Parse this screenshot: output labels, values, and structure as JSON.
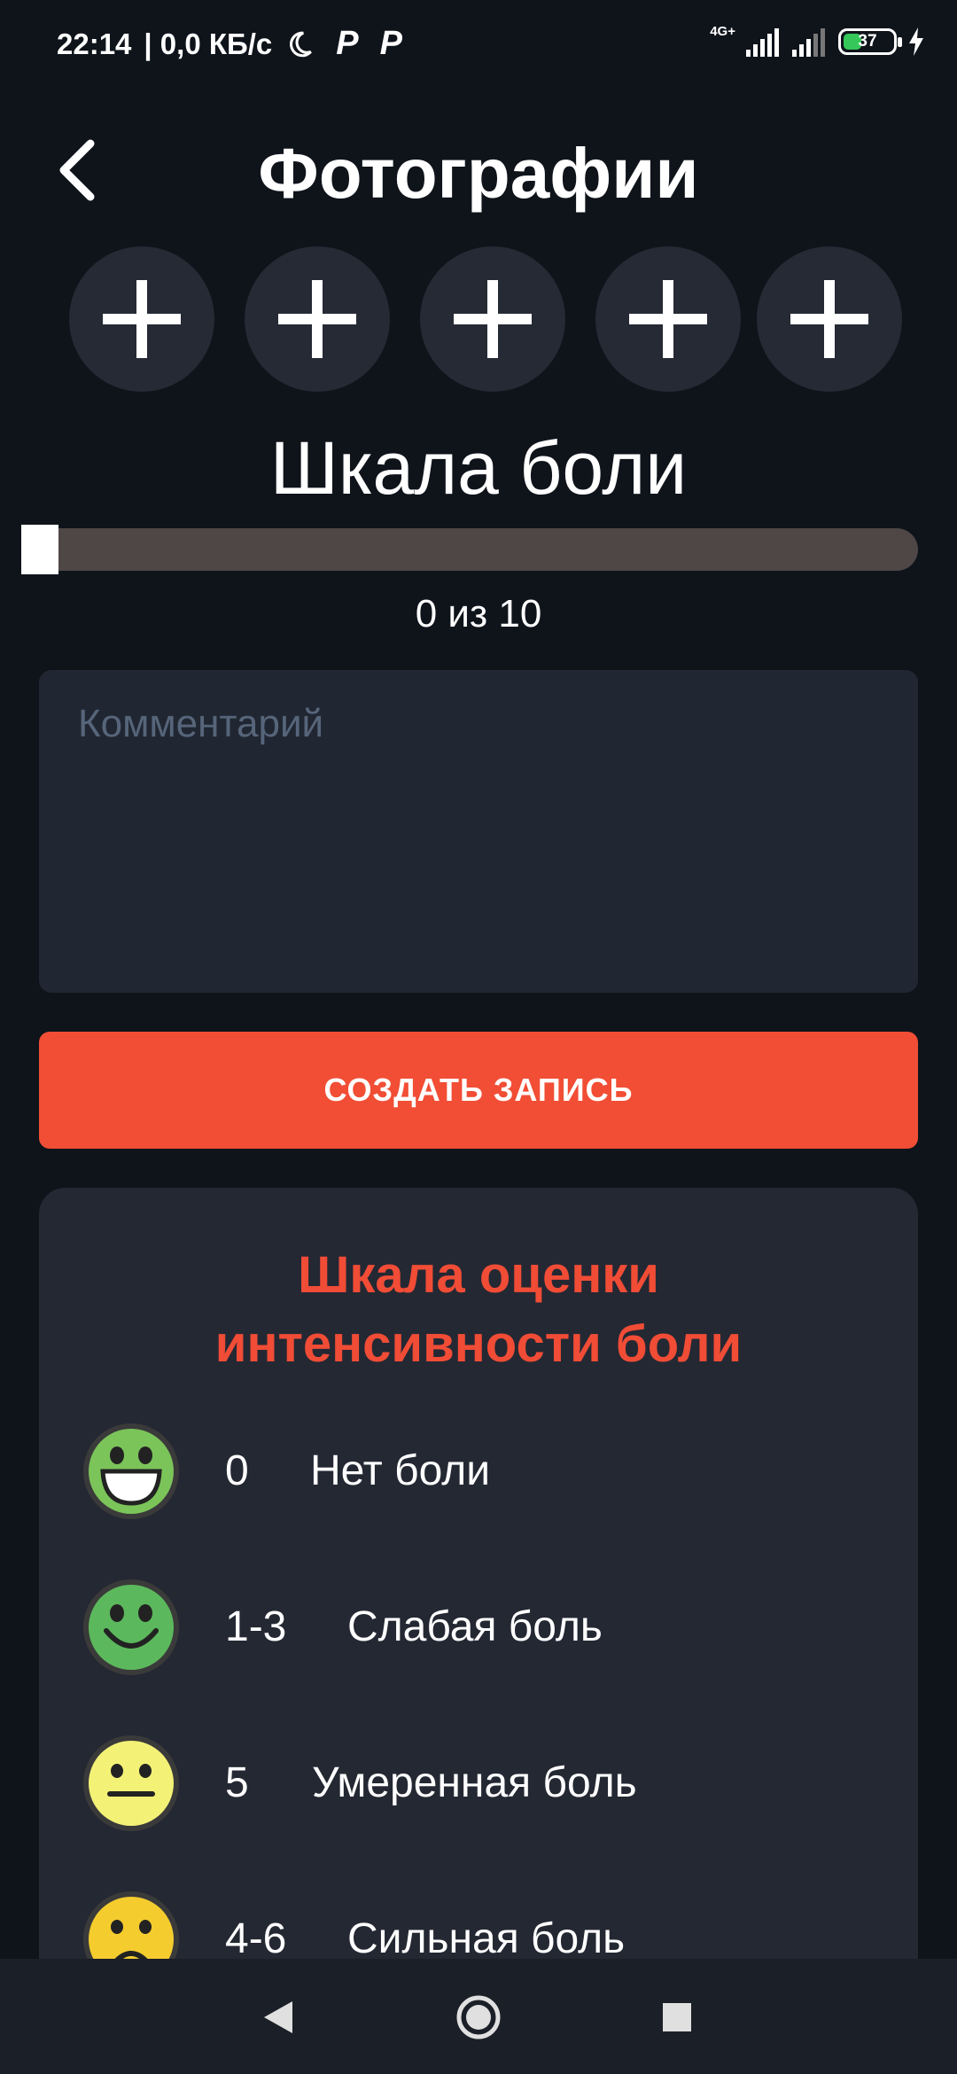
{
  "status_bar": {
    "time": "22:14",
    "network_speed": "| 0,0 КБ/с",
    "network_label": "4G+",
    "battery": "37",
    "battery_level": 0.37
  },
  "header": {
    "back_icon": "chevron-left-icon",
    "title": "Фотографии"
  },
  "photos": {
    "slots": [
      {
        "icon": "plus-icon"
      },
      {
        "icon": "plus-icon"
      },
      {
        "icon": "plus-icon"
      },
      {
        "icon": "plus-icon"
      },
      {
        "icon": "plus-icon"
      }
    ]
  },
  "pain_scale": {
    "title": "Шкала боли",
    "value": 0,
    "max": 10,
    "value_label": "0 из 10"
  },
  "comment": {
    "placeholder": "Комментарий",
    "value": ""
  },
  "create_button": {
    "label": "СОЗДАТЬ ЗАПИСЬ"
  },
  "info_card": {
    "title_line1": "Шкала оценки",
    "title_line2": "интенсивности боли",
    "items": [
      {
        "range": "0",
        "label": "Нет боли",
        "face": "laughing-face-icon",
        "color": "#7bc45a"
      },
      {
        "range": "1-3",
        "label": "Слабая боль",
        "face": "smiling-face-icon",
        "color": "#5cb85c"
      },
      {
        "range": "5",
        "label": "Умеренная боль",
        "face": "neutral-face-icon",
        "color": "#f4f276"
      },
      {
        "range": "4-6",
        "label": "Сильная боль",
        "face": "frowning-face-icon",
        "color": "#f4cc2e"
      }
    ]
  },
  "colors": {
    "background": "#0f141b",
    "accent": "#f14e35",
    "card": "#242833",
    "input": "#212732"
  },
  "nav": {
    "back": "triangle-back-icon",
    "home": "circle-home-icon",
    "recents": "square-recents-icon"
  }
}
